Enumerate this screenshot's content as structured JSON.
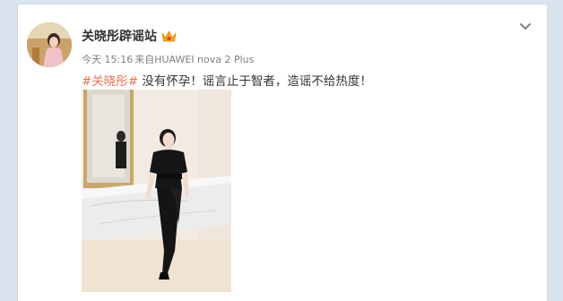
{
  "post": {
    "author_name": "关晓彤辟谣站",
    "verified_badge_icon": "crown-badge-icon",
    "timestamp": "今天 15:16",
    "source_prefix": "来自",
    "source_device": "HUAWEI nova 2 Plus",
    "hashtag": "#关晓彤#",
    "text": " 没有怀孕！谣言止于智者，造谣不给热度！",
    "colors": {
      "hashtag": "#eb7350",
      "author": "#333333",
      "meta": "#808080",
      "background": "#d9e4ef"
    }
  },
  "menu": {
    "icon": "chevron-down-icon"
  }
}
